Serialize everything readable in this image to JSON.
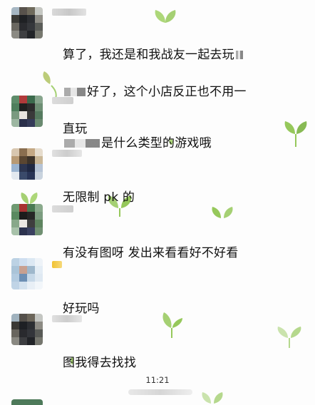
{
  "colors": {
    "sprout_green": "#9ccc65",
    "sprout_dark": "#7cb342",
    "text": "#111111",
    "timestamp": "#333333"
  },
  "messages": [
    {
      "avatar_icon": "avatar-pixelated",
      "lines": [
        "算了，我还是和我战友一起去玩",
        "好了，这个小店反正也不用一",
        "直玩"
      ]
    },
    {
      "avatar_icon": "avatar-pixelated",
      "text": "是什么类型的游戏哦"
    },
    {
      "avatar_icon": "avatar-pixelated",
      "text": "无限制 pk 的"
    },
    {
      "avatar_icon": "avatar-pixelated",
      "text": "有没有图呀 发出来看看好不好看"
    },
    {
      "avatar_icon": "avatar-pixelated",
      "text": "好玩吗"
    },
    {
      "avatar_icon": "avatar-pixelated",
      "text": "图我得去找找"
    }
  ],
  "timestamp": "11:21"
}
